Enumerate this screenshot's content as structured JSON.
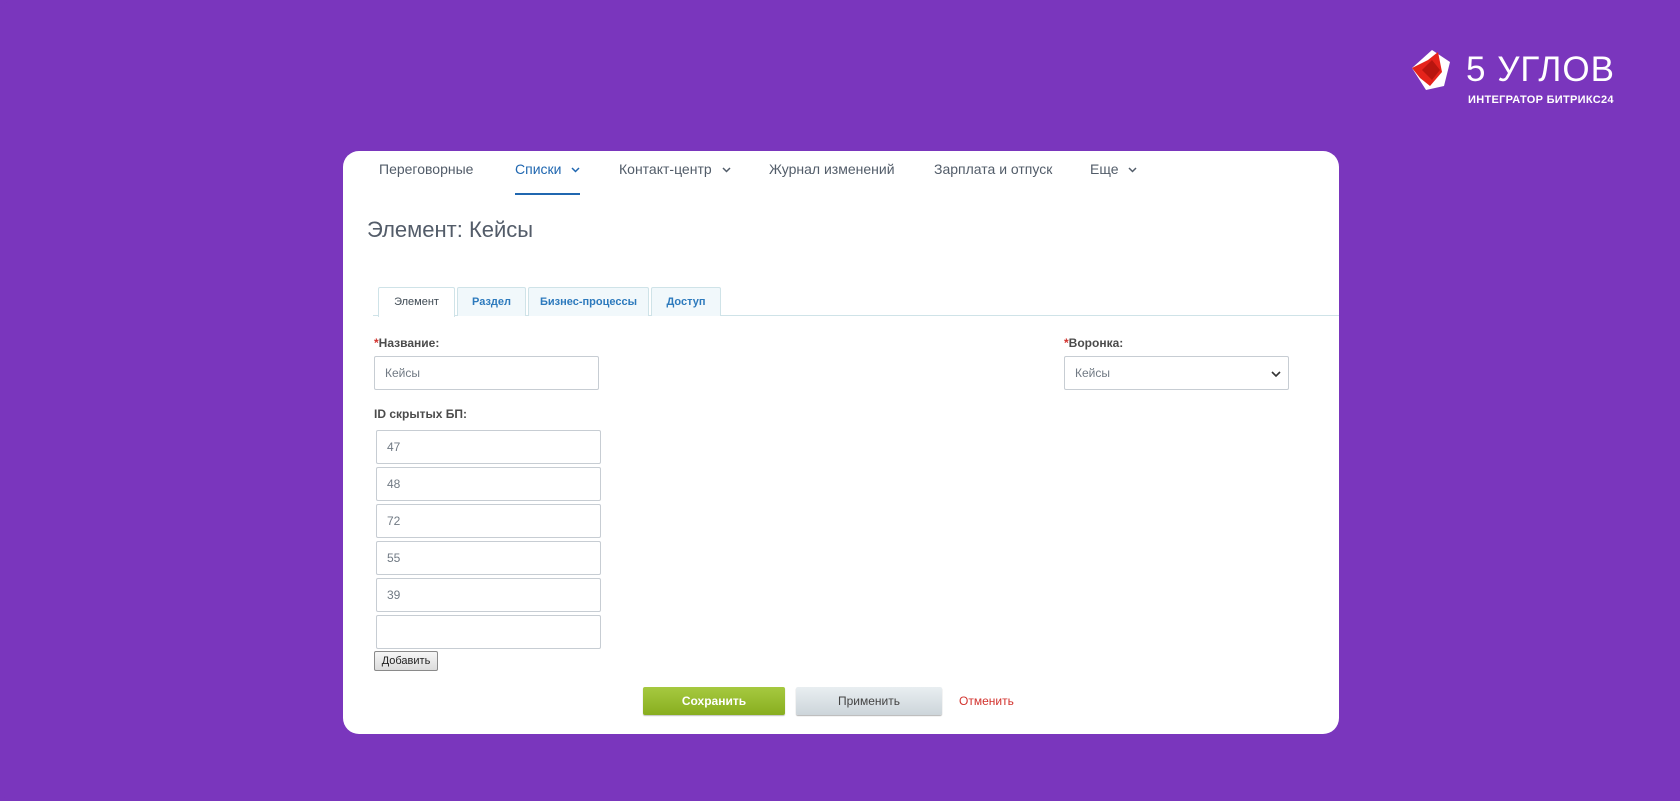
{
  "brand": {
    "name": "5 УГЛОВ",
    "tagline": "ИНТЕГРАТОР БИТРИКС24",
    "colors": {
      "background": "#7a36bd",
      "logo_mark": "#e5231b"
    }
  },
  "topnav": {
    "items": [
      {
        "label": "Переговорные",
        "has_dropdown": false,
        "active": false
      },
      {
        "label": "Списки",
        "has_dropdown": true,
        "active": true
      },
      {
        "label": "Контакт-центр",
        "has_dropdown": true,
        "active": false
      },
      {
        "label": "Журнал изменений",
        "has_dropdown": false,
        "active": false
      },
      {
        "label": "Зарплата и отпуск",
        "has_dropdown": false,
        "active": false
      },
      {
        "label": "Еще",
        "has_dropdown": true,
        "active": false
      }
    ]
  },
  "page": {
    "title": "Элемент: Кейсы"
  },
  "tabs": [
    {
      "label": "Элемент",
      "active": true
    },
    {
      "label": "Раздел",
      "active": false
    },
    {
      "label": "Бизнес-процессы",
      "active": false
    },
    {
      "label": "Доступ",
      "active": false
    }
  ],
  "form": {
    "name_field": {
      "required_mark": "*",
      "label": "Название:",
      "value": "Кейсы"
    },
    "funnel_field": {
      "required_mark": "*",
      "label": "Воронка:",
      "selected": "Кейсы"
    },
    "hidden_bp": {
      "label": "ID скрытых БП:",
      "values": [
        "47",
        "48",
        "72",
        "55",
        "39",
        ""
      ],
      "add_label": "Добавить"
    }
  },
  "actions": {
    "save": "Сохранить",
    "apply": "Применить",
    "cancel": "Отменить"
  }
}
